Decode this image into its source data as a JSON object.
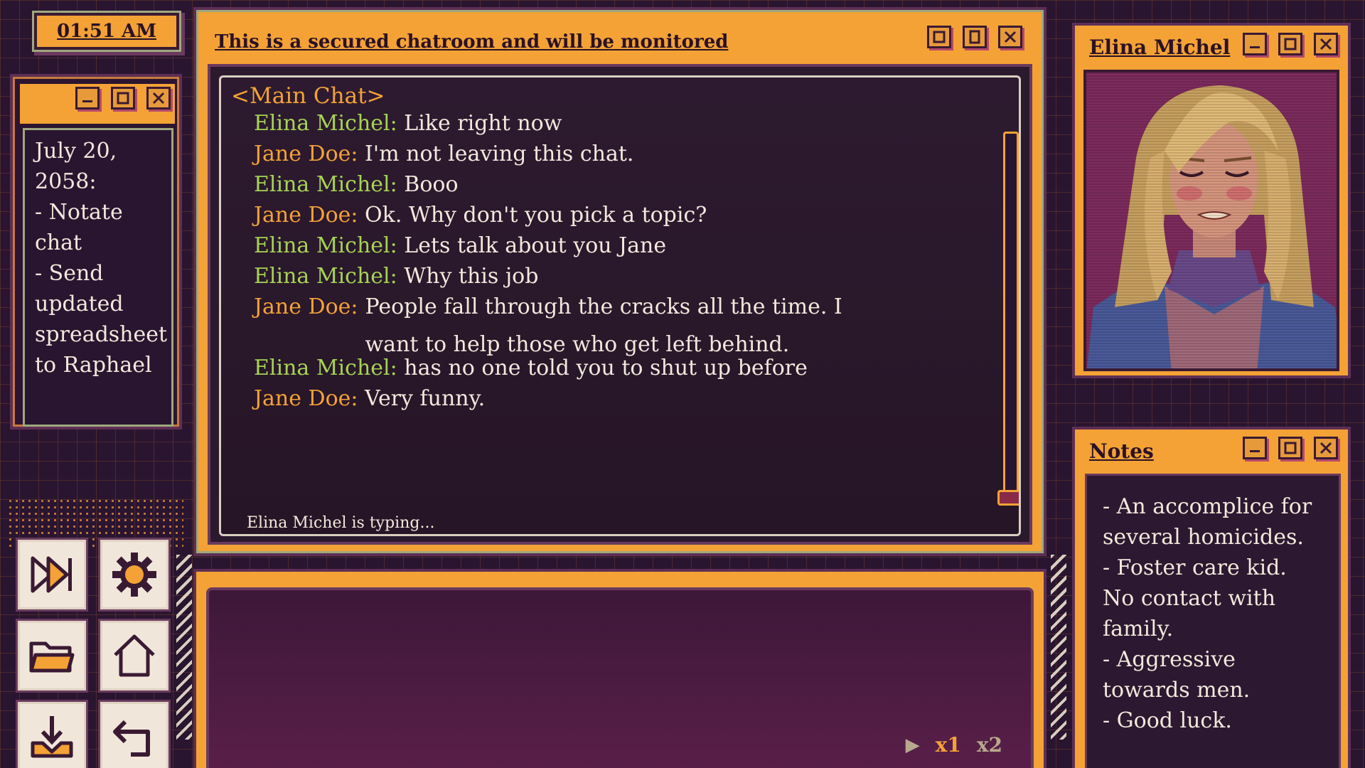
{
  "clock": "01:51 AM",
  "todo": {
    "text": "July 20,\n2058:\n- Notate\nchat\n- Send\nupdated\nspreadsheet\nto Raphael"
  },
  "chat": {
    "window_title": "This is a secured chatroom and will be monitored",
    "header": "<Main Chat>",
    "messages": [
      {
        "speaker": "Elina Michel:",
        "text": "Like right now",
        "who": "elina"
      },
      {
        "speaker": "Jane Doe:",
        "text": "I'm not leaving this chat.",
        "who": "jane"
      },
      {
        "speaker": "Elina Michel:",
        "text": "Booo",
        "who": "elina"
      },
      {
        "speaker": "Jane Doe:",
        "text": "Ok. Why don't you pick a topic?",
        "who": "jane"
      },
      {
        "speaker": "Elina Michel:",
        "text": "Lets talk about you Jane",
        "who": "elina"
      },
      {
        "speaker": "Elina Michel:",
        "text": "Why this job",
        "who": "elina"
      },
      {
        "speaker": "Jane Doe:",
        "text": "People fall through the cracks all the time. I want to help those who get left behind.",
        "who": "jane"
      },
      {
        "speaker": "Elina Michel:",
        "text": "has no one told you to shut up before",
        "who": "elina"
      },
      {
        "speaker": "Jane Doe:",
        "text": "Very funny.",
        "who": "jane"
      }
    ],
    "typing": "Elina Michel is typing..."
  },
  "speed": {
    "x1": "x1",
    "x2": "x2",
    "selected": "x1"
  },
  "portrait": {
    "name": "Elina Michel"
  },
  "notes": {
    "title": "Notes",
    "text": "- An accomplice for\nseveral homicides.\n- Foster care kid.\nNo contact with\nfamily.\n- Aggressive\ntowards men.\n- Good luck."
  },
  "tools": [
    "fast-forward-icon",
    "gear-icon",
    "folder-icon",
    "home-icon",
    "save-download-icon",
    "back-arrow-icon"
  ],
  "colors": {
    "accent": "#f4a235",
    "elina": "#a6d453",
    "jane": "#f4a235",
    "background": "#2a1530"
  }
}
